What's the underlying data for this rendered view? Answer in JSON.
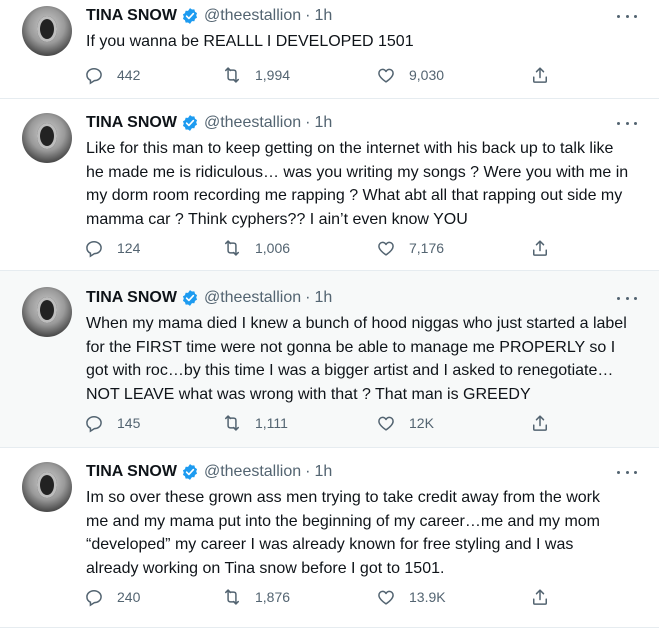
{
  "tweets": [
    {
      "name": "TINA SNOW",
      "handle": "@theestallion",
      "time": "1h",
      "text": "If you wanna be REALLL I DEVELOPED 1501",
      "replies": "442",
      "retweets": "1,994",
      "likes": "9,030"
    },
    {
      "name": "TINA SNOW",
      "handle": "@theestallion",
      "time": "1h",
      "text": "Like for this man to keep getting on the internet with his back up to talk like\nhe made me is ridiculous… was you writing my songs ? Were you with me in\nmy dorm room recording me rapping ? What abt all that rapping out side my\nmamma car ? Think cyphers?? I ain’t even know YOU",
      "replies": "124",
      "retweets": "1,006",
      "likes": "7,176"
    },
    {
      "name": "TINA SNOW",
      "handle": "@theestallion",
      "time": "1h",
      "text": "When my mama died I knew a bunch of hood niggas who just started a label\nfor the FIRST time were not gonna be able to manage me PROPERLY so I\ngot with roc…by this time I was a bigger artist and I asked to renegotiate…\nNOT LEAVE what was wrong with that ? That man is GREEDY",
      "replies": "145",
      "retweets": "1,111",
      "likes": "12K"
    },
    {
      "name": "TINA SNOW",
      "handle": "@theestallion",
      "time": "1h",
      "text": "Im so over these grown ass men trying to take credit away from the work\nme and my mama put into the beginning of my career…me and my mom\n“developed” my career I was already known for free styling and I was\nalready working on Tina snow before I got to 1501.",
      "replies": "240",
      "retweets": "1,876",
      "likes": "13.9K"
    }
  ],
  "icons": {
    "verified": "verified-badge-icon",
    "more": "more-options-icon",
    "reply": "reply-icon",
    "retweet": "retweet-icon",
    "like": "like-icon",
    "share": "share-icon"
  },
  "colors": {
    "accent": "#1d9bf0",
    "secondary_text": "#536471",
    "highlight_bg": "#f7f9f9"
  }
}
